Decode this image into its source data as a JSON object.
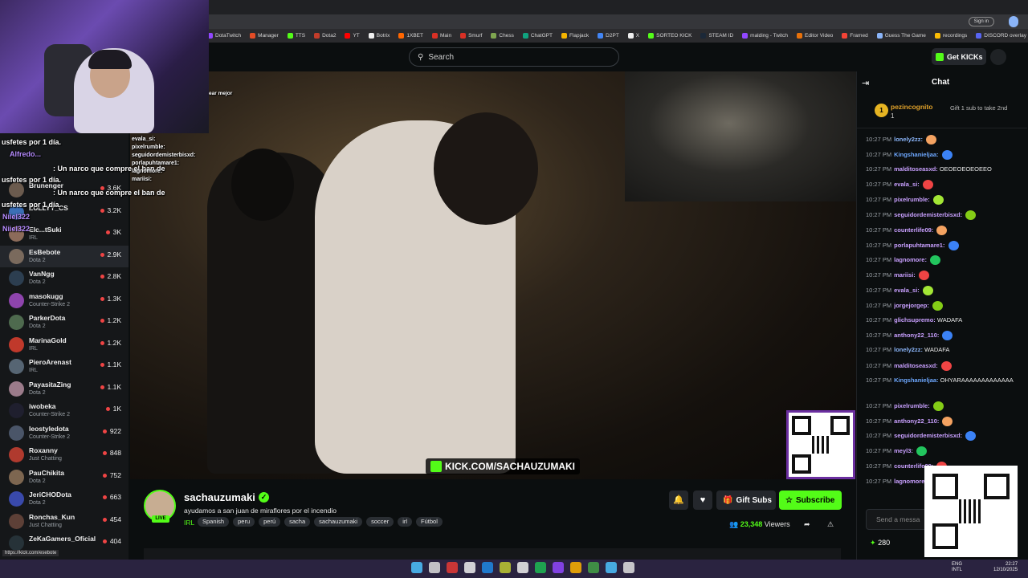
{
  "browser": {
    "bookmarks": [
      "DotaTwitch",
      "Manager",
      "TTS",
      "Dota2",
      "YT",
      "Botrix",
      "1XBET",
      "Main",
      "Smurf",
      "Chess",
      "ChatGPT",
      "Flapjack",
      "D2PT",
      "X",
      "SORTEO KICK",
      "STEAM ID",
      "malding - Twitch",
      "Editor Video",
      "Framed",
      "Guess The Game",
      "recordings",
      "DISCORD overlay"
    ],
    "signin": "Sign in",
    "status_url": "https://kick.com/esebote"
  },
  "header": {
    "search_placeholder": "Search",
    "get_kicks": "Get KICKs"
  },
  "sidebar": {
    "channels": [
      {
        "name": "Brunenger",
        "category": "",
        "viewers": "3.6K"
      },
      {
        "name": "ZULLYY_CS",
        "category": "",
        "viewers": "3.2K"
      },
      {
        "name": "Elc...tSuki",
        "category": "IRL",
        "viewers": "3K"
      },
      {
        "name": "EsBebote",
        "category": "Dota 2",
        "viewers": "2.9K"
      },
      {
        "name": "VanNgg",
        "category": "Dota 2",
        "viewers": "2.8K"
      },
      {
        "name": "masokugg",
        "category": "Counter-Strike 2",
        "viewers": "1.3K"
      },
      {
        "name": "ParkerDota",
        "category": "Dota 2",
        "viewers": "1.2K"
      },
      {
        "name": "MarinaGold",
        "category": "IRL",
        "viewers": "1.2K"
      },
      {
        "name": "PieroArenast",
        "category": "IRL",
        "viewers": "1.1K"
      },
      {
        "name": "PayasitaZing",
        "category": "Dota 2",
        "viewers": "1.1K"
      },
      {
        "name": "iwobeka",
        "category": "Counter-Strike 2",
        "viewers": "1K"
      },
      {
        "name": "leostyledota",
        "category": "Counter-Strike 2",
        "viewers": "922"
      },
      {
        "name": "Roxanny",
        "category": "Just Chatting",
        "viewers": "848"
      },
      {
        "name": "PauChikita",
        "category": "Dota 2",
        "viewers": "752"
      },
      {
        "name": "JeriCHODota",
        "category": "Dota 2",
        "viewers": "663"
      },
      {
        "name": "Ronchas_Kun",
        "category": "Just Chatting",
        "viewers": "454"
      },
      {
        "name": "ZeKaGamers_Oficial",
        "category": "",
        "viewers": "404"
      }
    ]
  },
  "overlay_chat": {
    "line1": "usfetes por 1 día.",
    "line2": ": Un narco que compre el ban de",
    "line3": "usfetes por 1 día.",
    "line4": ": Un narco que compre el ban de",
    "line5": "usfetes por 1 día.",
    "user1": "Alfredo...",
    "user2": "Niiel322",
    "user3": "Niiel322",
    "fragment": "ear mejor",
    "mini": [
      "evala_si:",
      "pixelrumble:",
      "seguidordemisterbisxd:",
      "porlapuhtamare1:",
      "lagnomore:",
      "mariisi:"
    ]
  },
  "stream": {
    "watermark": "KICK.COM/SACHAUZUMAKI",
    "channel_name": "sachauzumaki",
    "live": "LIVE",
    "title": "ayudamos a san juan de miraflores por el incendio",
    "category": "IRL",
    "tags": [
      "Spanish",
      "peru",
      "perú",
      "sacha",
      "sachauzumaki",
      "soccer",
      "irl",
      "Fútbol"
    ],
    "gift_subs": "Gift Subs",
    "subscribe": "Subscribe",
    "viewers": "23,348",
    "viewers_label": "Viewers"
  },
  "chat": {
    "title": "Chat",
    "pinned": {
      "rank": "1",
      "user": "pezincognito",
      "count": "1",
      "note": "Gift 1 sub to take 2nd"
    },
    "messages": [
      {
        "time": "10:27 PM",
        "user": "lonely2zz:",
        "text": "",
        "color": "#8ab4f8"
      },
      {
        "time": "10:27 PM",
        "user": "Kingshanieljaa:",
        "text": "",
        "color": "#6ea8ff"
      },
      {
        "time": "10:27 PM",
        "user": "malditoseasxd:",
        "text": "OEOEOEOEOEEO",
        "color": "#c9a0ff"
      },
      {
        "time": "10:27 PM",
        "user": "evala_si:",
        "text": "",
        "color": "#c9a0ff"
      },
      {
        "time": "10:27 PM",
        "user": "pixelrumble:",
        "text": "",
        "color": "#c9a0ff"
      },
      {
        "time": "10:27 PM",
        "user": "seguidordemisterbisxd:",
        "text": "",
        "color": "#c9a0ff"
      },
      {
        "time": "10:27 PM",
        "user": "counterlife09:",
        "text": "",
        "color": "#c9a0ff"
      },
      {
        "time": "10:27 PM",
        "user": "porlapuhtamare1:",
        "text": "",
        "color": "#c9a0ff"
      },
      {
        "time": "10:27 PM",
        "user": "lagnomore:",
        "text": "",
        "color": "#c9a0ff"
      },
      {
        "time": "10:27 PM",
        "user": "mariisi:",
        "text": "",
        "color": "#c9a0ff"
      },
      {
        "time": "10:27 PM",
        "user": "evala_si:",
        "text": "",
        "color": "#c9a0ff"
      },
      {
        "time": "10:27 PM",
        "user": "jorgejorgep:",
        "text": "",
        "color": "#c9a0ff"
      },
      {
        "time": "10:27 PM",
        "user": "glichsupremo:",
        "text": "WADAFA",
        "color": "#c9a0ff"
      },
      {
        "time": "10:27 PM",
        "user": "anthony22_110:",
        "text": "",
        "color": "#c9a0ff"
      },
      {
        "time": "10:27 PM",
        "user": "lonely2zz:",
        "text": "WADAFA",
        "color": "#8ab4f8"
      },
      {
        "time": "10:27 PM",
        "user": "malditoseasxd:",
        "text": "",
        "color": "#c9a0ff"
      },
      {
        "time": "10:27 PM",
        "user": "Kingshanieljaa:",
        "text": "OHYARAAAAAAAAAAAAA",
        "color": "#6ea8ff"
      },
      {
        "time": "10:27 PM",
        "user": "pixelrumble:",
        "text": "",
        "color": "#c9a0ff"
      },
      {
        "time": "10:27 PM",
        "user": "anthony22_110:",
        "text": "",
        "color": "#c9a0ff"
      },
      {
        "time": "10:27 PM",
        "user": "seguidordemisterbisxd:",
        "text": "",
        "color": "#c9a0ff"
      },
      {
        "time": "10:27 PM",
        "user": "meyl3:",
        "text": "",
        "color": "#c9a0ff"
      },
      {
        "time": "10:27 PM",
        "user": "counterlife09:",
        "text": "",
        "color": "#c9a0ff"
      },
      {
        "time": "10:27 PM",
        "user": "lagnomore",
        "text": "",
        "color": "#c9a0ff"
      }
    ],
    "input_placeholder": "Send a messa",
    "points": "280"
  },
  "taskbar": {
    "lang1": "ENG",
    "lang2": "INTL",
    "time": "22:27",
    "date": "12/10/2025"
  }
}
